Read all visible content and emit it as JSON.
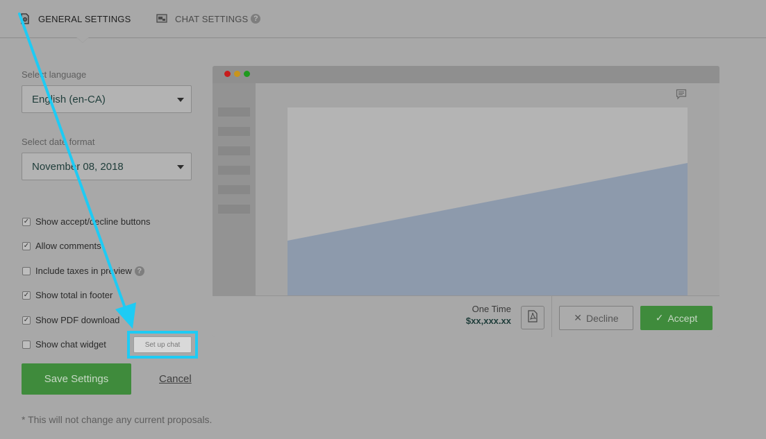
{
  "tabs": {
    "general": "GENERAL SETTINGS",
    "chat": "CHAT SETTINGS",
    "chat_help": "?"
  },
  "form": {
    "language_label": "Select language",
    "language_value": "English (en-CA)",
    "date_label": "Select date format",
    "date_value": "November 08, 2018",
    "checkboxes": [
      {
        "label": "Show accept/decline buttons",
        "checked": true
      },
      {
        "label": "Allow comments",
        "checked": true
      },
      {
        "label": "Include taxes in preview",
        "checked": false,
        "help": "?"
      },
      {
        "label": "Show total in footer",
        "checked": true
      },
      {
        "label": "Show PDF download",
        "checked": true
      },
      {
        "label": "Show chat widget",
        "checked": false
      }
    ],
    "setup_chat": "Set up chat",
    "save": "Save Settings",
    "cancel": "Cancel",
    "footnote": "* This will not change any current proposals."
  },
  "preview": {
    "one_time_label": "One Time",
    "one_time_amount": "$xx,xxx.xx",
    "decline": "Decline",
    "accept": "Accept"
  },
  "icons": {
    "general_tab": "gear-document-icon",
    "chat_tab": "chat-window-icon",
    "comment": "comment-icon",
    "pdf": "pdf-icon",
    "decline": "x-icon",
    "accept": "check-icon"
  },
  "colors": {
    "accent_green": "#3f8b3c",
    "highlight_cyan": "#1ecbf4",
    "dot_red": "#c81d1d",
    "dot_amber": "#c9951d",
    "dot_green": "#1e9a1e"
  }
}
